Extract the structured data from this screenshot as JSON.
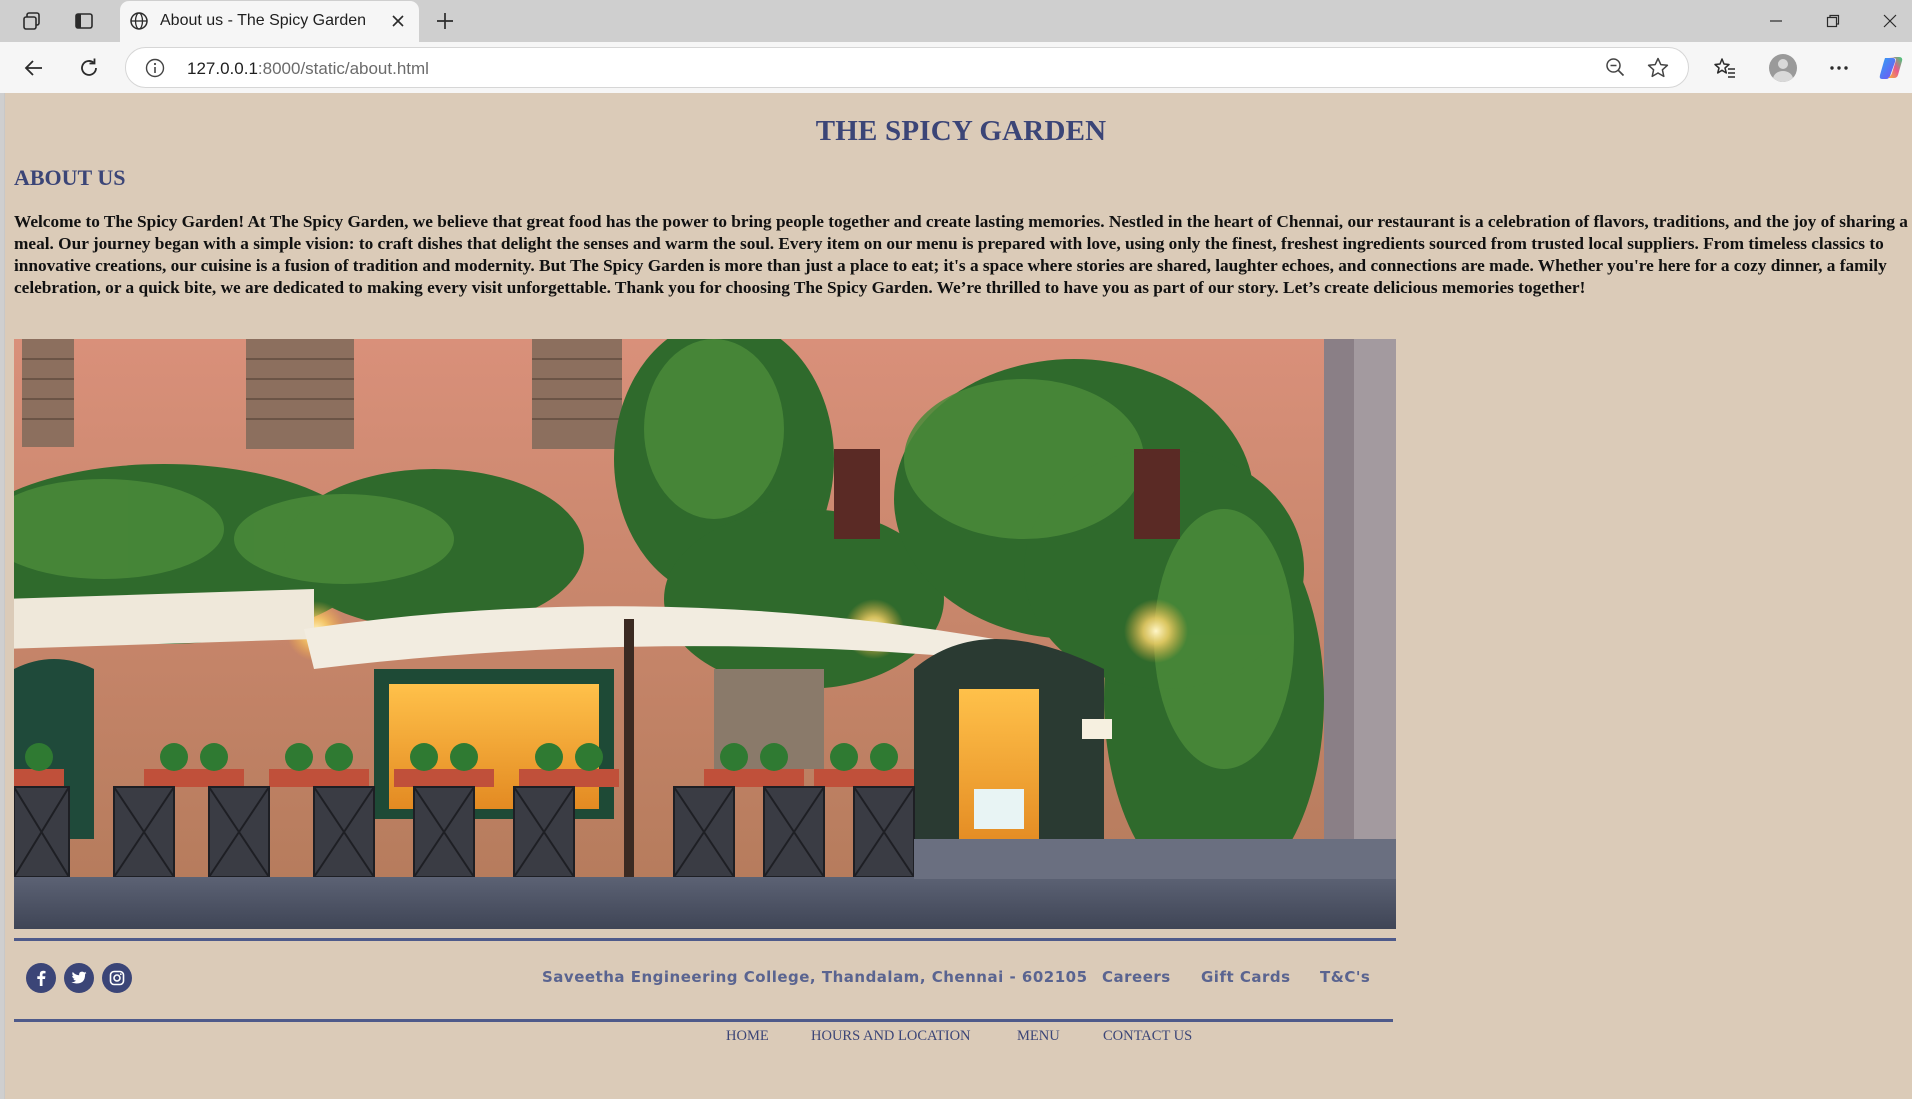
{
  "browser": {
    "tab_title": "About us - The Spicy Garden",
    "url_host": "127.0.0.1",
    "url_rest": ":8000/static/about.html",
    "icons": [
      "workspaces-icon",
      "tab-actions-icon",
      "globe-icon",
      "close-icon",
      "plus-icon",
      "minimize-icon",
      "restore-icon",
      "window-close-icon",
      "back-icon",
      "refresh-icon",
      "info-icon",
      "zoom-out-icon",
      "star-icon",
      "favorites-icon",
      "profile-icon",
      "more-icon",
      "copilot-icon"
    ]
  },
  "page": {
    "site_title": "THE SPICY GARDEN",
    "heading": "ABOUT US",
    "paragraph": "Welcome to The Spicy Garden! At The Spicy Garden, we believe that great food has the power to bring people together and create lasting memories. Nestled in the heart of Chennai, our restaurant is a celebration of flavors, traditions, and the joy of sharing a meal. Our journey began with a simple vision: to craft dishes that delight the senses and warm the soul. Every item on our menu is prepared with love, using only the finest, freshest ingredients sourced from trusted local suppliers. From timeless classics to innovative creations, our cuisine is a fusion of tradition and modernity. But The Spicy Garden is more than just a place to eat; it's a space where stories are shared, laughter echoes, and connections are made. Whether you're here for a cozy dinner, a family celebration, or a quick bite, we are dedicated to making every visit unforgettable. Thank you for choosing The Spicy Garden. We’re thrilled to have you as part of our story. Let’s create delicious memories together!"
  },
  "footer": {
    "social": [
      "facebook-icon",
      "twitter-icon",
      "instagram-icon"
    ],
    "address": "Saveetha Engineering College, Thandalam, Chennai - 602105",
    "links": [
      "Careers",
      "Gift Cards",
      "T&C's"
    ]
  },
  "nav": [
    "HOME",
    "HOURS AND LOCATION",
    "MENU",
    "CONTACT US"
  ],
  "colors": {
    "page_background": "#dbcbb8",
    "brand_navy": "#3b4577",
    "footer_text": "#5a6490",
    "browser_chrome": "#cfcfcf"
  }
}
